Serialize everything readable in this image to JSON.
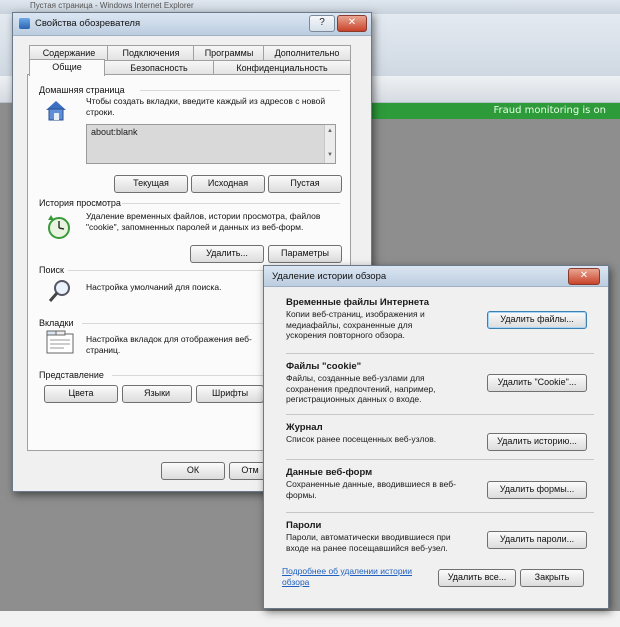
{
  "browser": {
    "title": "Пустая страница - Windows Internet Explorer",
    "status_text": "Fraud monitoring is on"
  },
  "options_dialog": {
    "title": "Свойства обозревателя",
    "help_label": "?",
    "close_label": "✕",
    "tabs_row1": [
      "Содержание",
      "Подключения",
      "Программы",
      "Дополнительно"
    ],
    "tabs_row2": [
      "Общие",
      "Безопасность",
      "Конфиденциальность"
    ],
    "home": {
      "label": "Домашняя страница",
      "desc": "Чтобы создать вкладки, введите каждый из адресов с новой строки.",
      "value": "about:blank",
      "buttons": [
        "Текущая",
        "Исходная",
        "Пустая"
      ]
    },
    "history": {
      "label": "История просмотра",
      "desc": "Удаление временных файлов, истории просмотра, файлов \"cookie\", запомненных паролей и данных из веб-форм.",
      "delete_button": "Удалить...",
      "params_button": "Параметры"
    },
    "search": {
      "label": "Поиск",
      "desc": "Настройка умолчаний для поиска."
    },
    "tabs_group": {
      "label": "Вкладки",
      "desc": "Настройка вкладок для отображения веб-страниц."
    },
    "view": {
      "label": "Представление",
      "buttons": [
        "Цвета",
        "Языки",
        "Шрифты"
      ]
    },
    "ok_button": "ОК",
    "cancel_button": "Отм"
  },
  "delete_dialog": {
    "title": "Удаление истории обзора",
    "close_label": "✕",
    "sections": [
      {
        "title": "Временные файлы Интернета",
        "desc": "Копии веб-страниц, изображения и медиафайлы, сохраненные для ускорения повторного обзора.",
        "button": "Удалить файлы..."
      },
      {
        "title": "Файлы \"cookie\"",
        "desc": "Файлы, созданные веб-узлами для сохранения предпочтений, например, регистрационных данных о входе.",
        "button": "Удалить \"Cookie\"..."
      },
      {
        "title": "Журнал",
        "desc": "Список ранее посещенных веб-узлов.",
        "button": "Удалить историю..."
      },
      {
        "title": "Данные веб-форм",
        "desc": "Сохраненные данные, вводившиеся в веб-формы.",
        "button": "Удалить формы..."
      },
      {
        "title": "Пароли",
        "desc": "Пароли, автоматически вводившиеся при входе на ранее посещавшийся веб-узел.",
        "button": "Удалить пароли..."
      }
    ],
    "more_link": "Подробнее об удалении истории обзора",
    "delete_all_button": "Удалить все...",
    "close_button": "Закрыть"
  }
}
